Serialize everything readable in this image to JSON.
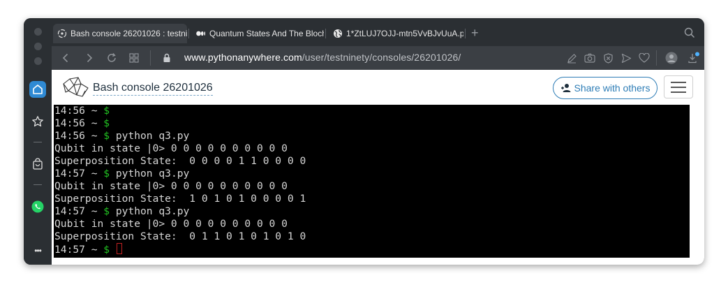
{
  "browser": {
    "tabs": [
      {
        "label": "Bash console 26201026 : testni",
        "icon": "pythonanywhere-icon",
        "active": true
      },
      {
        "label": "Quantum States And The Bloch",
        "icon": "medium-icon",
        "active": false
      },
      {
        "label": "1*ZtLUJ7OJJ-mtn5VvBJvUuA.p",
        "icon": "globe-icon",
        "active": false
      }
    ],
    "new_tab_label": "+",
    "url": {
      "host": "www.pythonanywhere.com",
      "path": "/user/testninety/consoles/26201026/"
    }
  },
  "sidebar": {
    "more_label": "•••"
  },
  "header": {
    "title": "Bash console 26201026",
    "share_label": "Share with others"
  },
  "terminal": {
    "lines": [
      {
        "time": "14:56 ~ ",
        "dollar": "$",
        "text": ""
      },
      {
        "time": "14:56 ~ ",
        "dollar": "$",
        "text": ""
      },
      {
        "time": "14:56 ~ ",
        "dollar": "$",
        "text": " python q3.py"
      },
      {
        "time": "",
        "dollar": "",
        "text": "Qubit in state |0> 0 0 0 0 0 0 0 0 0 0"
      },
      {
        "time": "",
        "dollar": "",
        "text": "Superposition State:  0 0 0 0 1 1 0 0 0 0"
      },
      {
        "time": "14:57 ~ ",
        "dollar": "$",
        "text": " python q3.py"
      },
      {
        "time": "",
        "dollar": "",
        "text": "Qubit in state |0> 0 0 0 0 0 0 0 0 0 0"
      },
      {
        "time": "",
        "dollar": "",
        "text": "Superposition State:  1 0 1 0 1 0 0 0 0 1"
      },
      {
        "time": "14:57 ~ ",
        "dollar": "$",
        "text": " python q3.py"
      },
      {
        "time": "",
        "dollar": "",
        "text": "Qubit in state |0> 0 0 0 0 0 0 0 0 0 0"
      },
      {
        "time": "",
        "dollar": "",
        "text": "Superposition State:  0 1 1 0 1 0 1 0 1 0"
      },
      {
        "time": "14:57 ~ ",
        "dollar": "$",
        "text": " ",
        "cursor": true
      }
    ]
  },
  "colors": {
    "prompt_dollar": "#22c322",
    "terminal_bg": "#000000",
    "terminal_fg": "#d6d6d6",
    "accent": "#2e7db6"
  }
}
